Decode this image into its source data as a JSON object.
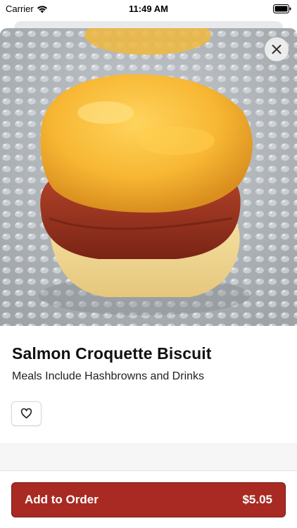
{
  "status_bar": {
    "carrier": "Carrier",
    "time": "11:49 AM",
    "icons": [
      "wifi-icon",
      "battery-icon"
    ]
  },
  "product": {
    "image_alt_icon": "food-photo",
    "title": "Salmon Croquette Biscuit",
    "subtitle": "Meals Include Hashbrowns and Drinks",
    "favorite_icon": "heart-icon"
  },
  "header": {
    "close_icon": "close-icon"
  },
  "footer": {
    "add_label": "Add to Order",
    "price": "$5.05"
  },
  "colors": {
    "accent": "#a82a22",
    "accent_border": "#7a1a14",
    "background": "#ffffff",
    "band": "#f6f6f6"
  }
}
